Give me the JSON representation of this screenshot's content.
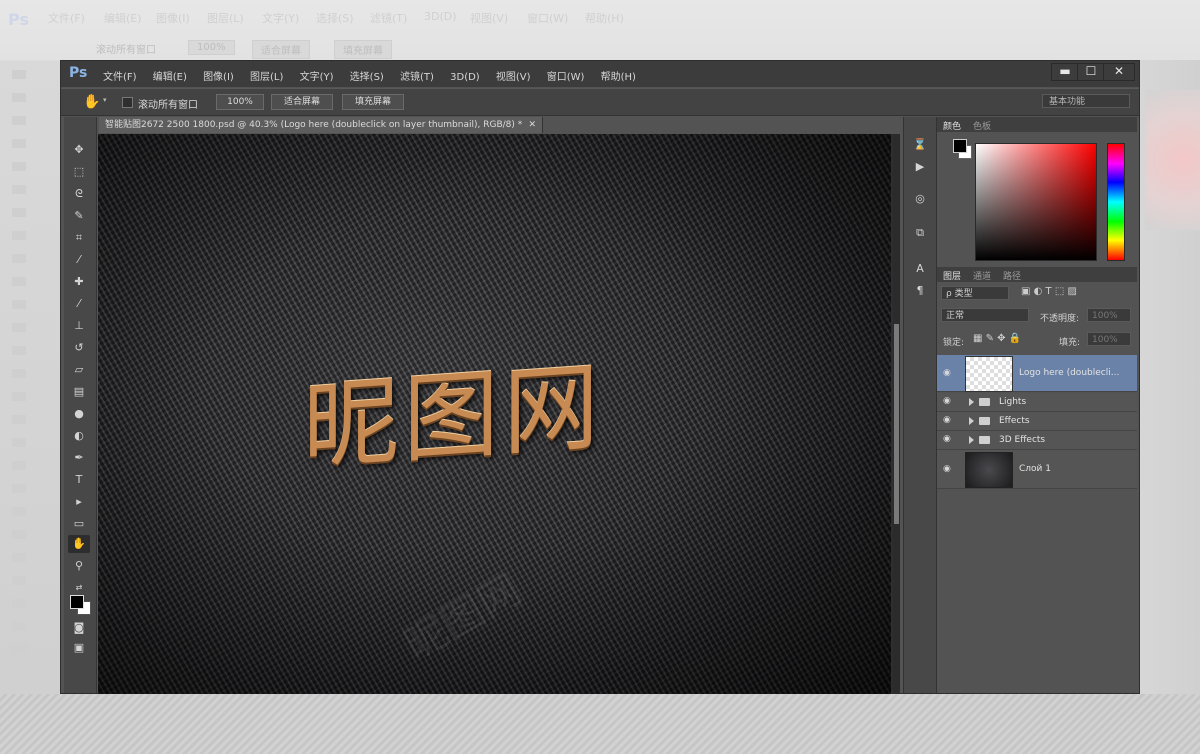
{
  "menu": {
    "logo": "Ps",
    "items": [
      "文件(F)",
      "编辑(E)",
      "图像(I)",
      "图层(L)",
      "文字(Y)",
      "选择(S)",
      "滤镜(T)",
      "3D(D)",
      "视图(V)",
      "窗口(W)",
      "帮助(H)"
    ]
  },
  "window": {
    "minimize": "▬",
    "maximize": "☐",
    "close": "✕"
  },
  "options": {
    "hand_icon": "hand-icon",
    "scroll_all_label": "滚动所有窗口",
    "zoom_label": "100%",
    "fit_screen_label": "适合屏幕",
    "fill_screen_label": "填充屏幕",
    "workspace": "基本功能"
  },
  "document": {
    "tab_title": "智能贴图2672 2500 1800.psd @ 40.3% (Logo here (doubleclick on layer thumbnail), RGB/8) *",
    "tab_close": "✕",
    "canvas_text": "昵图网",
    "watermark": "昵图网"
  },
  "color_panel": {
    "tabs": [
      "颜色",
      "色板"
    ],
    "fg": "#000000",
    "bg": "#ffffff"
  },
  "layers_panel": {
    "tabs": [
      "图层",
      "通道",
      "路径"
    ],
    "kind_label": "ρ 类型",
    "blend_mode": "正常",
    "opacity_label": "不透明度:",
    "opacity_value": "100%",
    "lock_label": "锁定:",
    "fill_label": "填充:",
    "fill_value": "100%",
    "layers": [
      {
        "name": "Logo here (doublecli...",
        "type": "smart",
        "selected": true,
        "eye": "◉"
      },
      {
        "name": "Lights",
        "type": "group",
        "selected": false,
        "eye": "◉"
      },
      {
        "name": "Effects",
        "type": "group",
        "selected": false,
        "eye": "◉"
      },
      {
        "name": "3D Effects",
        "type": "group",
        "selected": false,
        "eye": "◉"
      },
      {
        "name": "Слой 1",
        "type": "image",
        "selected": false,
        "eye": "◉"
      }
    ]
  },
  "colors": {
    "ps_blue": "#8cb4e6",
    "selected_layer": "#6b82a8",
    "ui_dark": "#535353"
  }
}
